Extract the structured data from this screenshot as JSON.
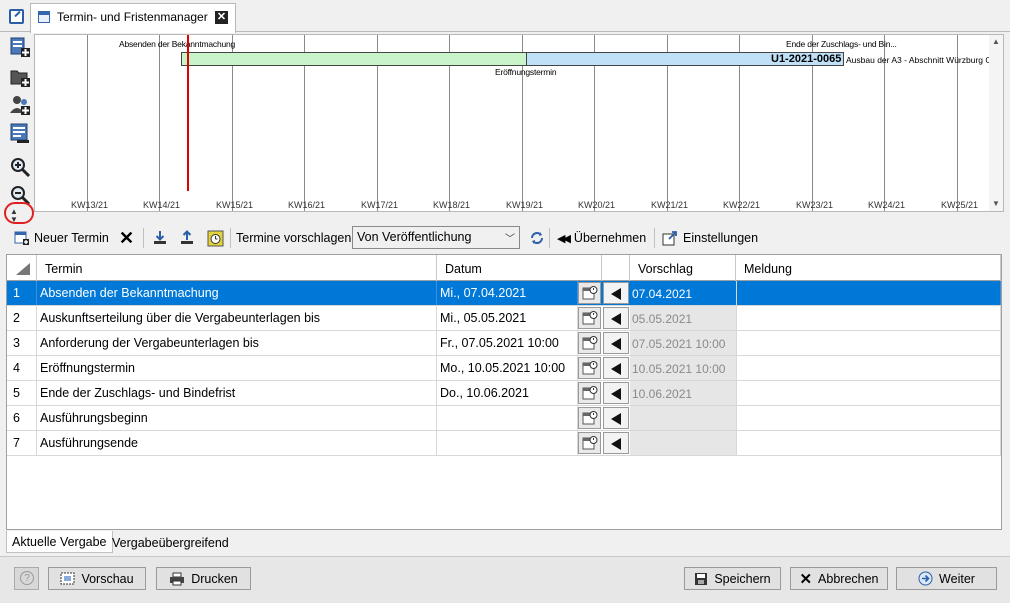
{
  "window": {
    "tab_title": "Termin- und Fristenmanager"
  },
  "timeline": {
    "weeks": [
      "KW13/21",
      "KW14/21",
      "KW15/21",
      "KW16/21",
      "KW17/21",
      "KW18/21",
      "KW19/21",
      "KW20/21",
      "KW21/21",
      "KW22/21",
      "KW23/21",
      "KW24/21",
      "KW25/21"
    ],
    "annotations": {
      "start": "Absenden der Bekanntmachung",
      "end": "Ende der Zuschlags- und Bin...",
      "middle": "Eröffnungstermin"
    },
    "bar_id": "U1-2021-0065",
    "bar_description": "Ausbau der A3 - Abschnitt Würzburg O",
    "colors": {
      "phase1": "#c9f3c9",
      "phase2": "#bfe0f7",
      "today": "#e00000"
    }
  },
  "toolbar": {
    "new_label": "Neuer Termin",
    "suggest_label": "Termine vorschlagen:",
    "suggest_value": "Von Veröffentlichung",
    "apply_label": "Übernehmen",
    "settings_label": "Einstellungen"
  },
  "grid": {
    "headers": {
      "termin": "Termin",
      "datum": "Datum",
      "vorschlag": "Vorschlag",
      "meldung": "Meldung"
    },
    "rows": [
      {
        "nr": "1",
        "termin": "Absenden der Bekanntmachung",
        "datum": "Mi., 07.04.2021",
        "vorschlag": "07.04.2021",
        "meldung": ""
      },
      {
        "nr": "2",
        "termin": "Auskunftserteilung über die Vergabeunterlagen bis",
        "datum": "Mi., 05.05.2021",
        "vorschlag": "05.05.2021",
        "meldung": ""
      },
      {
        "nr": "3",
        "termin": "Anforderung der Vergabeunterlagen bis",
        "datum": "Fr., 07.05.2021 10:00",
        "vorschlag": "07.05.2021 10:00",
        "meldung": ""
      },
      {
        "nr": "4",
        "termin": "Eröffnungstermin",
        "datum": "Mo., 10.05.2021 10:00",
        "vorschlag": "10.05.2021 10:00",
        "meldung": ""
      },
      {
        "nr": "5",
        "termin": "Ende der Zuschlags- und Bindefrist",
        "datum": "Do., 10.06.2021",
        "vorschlag": "10.06.2021",
        "meldung": ""
      },
      {
        "nr": "6",
        "termin": "Ausführungsbeginn",
        "datum": "",
        "vorschlag": "",
        "meldung": ""
      },
      {
        "nr": "7",
        "termin": "Ausführungsende",
        "datum": "",
        "vorschlag": "",
        "meldung": ""
      }
    ],
    "selected_row": "1",
    "selection_color": "#0078d7"
  },
  "bottom_tabs": {
    "current": "Aktuelle Vergabe",
    "global": "Vergabeübergreifend"
  },
  "footer": {
    "preview": "Vorschau",
    "print": "Drucken",
    "save": "Speichern",
    "cancel": "Abbrechen",
    "next": "Weiter"
  }
}
